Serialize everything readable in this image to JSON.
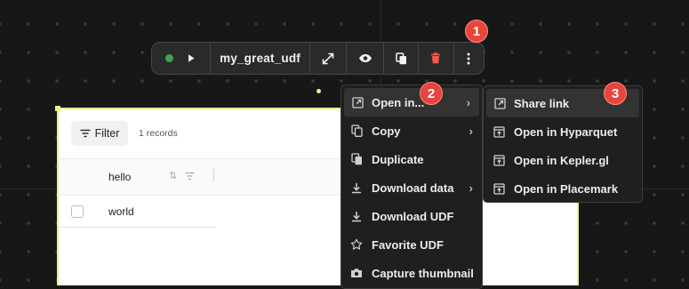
{
  "toolbar": {
    "udf_name": "my_great_udf",
    "status_color": "#3fa34d",
    "icons": [
      "play-icon",
      "expand-icon",
      "eye-icon",
      "duplicate-icon",
      "trash-icon",
      "more-vertical-icon"
    ]
  },
  "panel": {
    "filter_label": "Filter",
    "records_text": "1 records",
    "column_header": "hello",
    "rows": [
      {
        "value": "world"
      }
    ]
  },
  "main_menu": {
    "items": [
      {
        "label": "Open in...",
        "icon": "external-link-icon",
        "has_submenu": true,
        "active": true
      },
      {
        "label": "Copy",
        "icon": "copy-icon",
        "has_submenu": true
      },
      {
        "label": "Duplicate",
        "icon": "duplicate-icon"
      },
      {
        "label": "Download data",
        "icon": "download-icon",
        "has_submenu": true
      },
      {
        "label": "Download UDF",
        "icon": "download-icon"
      },
      {
        "label": "Favorite UDF",
        "icon": "star-icon"
      },
      {
        "label": "Capture thumbnail",
        "icon": "camera-icon"
      }
    ]
  },
  "submenu": {
    "items": [
      {
        "label": "Share link",
        "icon": "external-link-icon",
        "active": true
      },
      {
        "label": "Open in Hyparquet",
        "icon": "open-window-icon"
      },
      {
        "label": "Open in Kepler.gl",
        "icon": "open-window-icon"
      },
      {
        "label": "Open in Placemark",
        "icon": "open-window-icon"
      }
    ]
  },
  "badges": [
    "1",
    "2",
    "3"
  ],
  "colors": {
    "accent_badge": "#e8453c",
    "panel_border": "#e6f58a",
    "danger": "#f05a4a"
  }
}
